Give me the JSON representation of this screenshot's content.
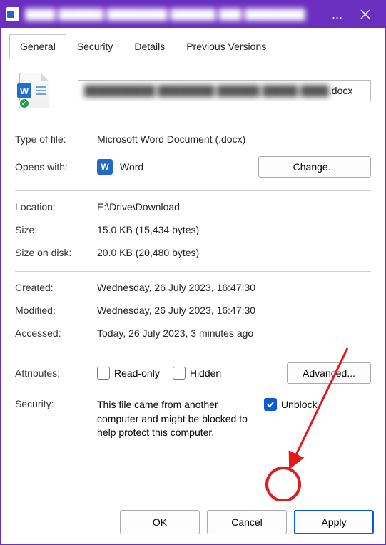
{
  "window": {
    "title_blurred": "████ ██████ ████████ ██████ ███ ████████",
    "ellipsis": "..."
  },
  "tabs": {
    "general": "General",
    "security": "Security",
    "details": "Details",
    "previous": "Previous Versions"
  },
  "file": {
    "name_blurred": "██████████ ████████ ██████ █████ ████",
    "ext": ".docx"
  },
  "fields": {
    "type_label": "Type of file:",
    "type_value": "Microsoft Word Document (.docx)",
    "opens_label": "Opens with:",
    "opens_value": "Word",
    "change_btn": "Change...",
    "location_label": "Location:",
    "location_value": "E:\\Drive\\Download",
    "size_label": "Size:",
    "size_value": "15.0 KB (15,434 bytes)",
    "sizedisk_label": "Size on disk:",
    "sizedisk_value": "20.0 KB (20,480 bytes)",
    "created_label": "Created:",
    "created_value": "Wednesday, 26 July 2023, 16:47:30",
    "modified_label": "Modified:",
    "modified_value": "Wednesday, 26 July 2023, 16:47:30",
    "accessed_label": "Accessed:",
    "accessed_value": "Today, 26 July 2023, 3 minutes ago",
    "attributes_label": "Attributes:",
    "readonly_label": "Read-only",
    "hidden_label": "Hidden",
    "advanced_btn": "Advanced...",
    "security_label": "Security:",
    "security_text": "This file came from another computer and might be blocked to help protect this computer.",
    "unblock_label": "Unblock"
  },
  "footer": {
    "ok": "OK",
    "cancel": "Cancel",
    "apply": "Apply"
  }
}
